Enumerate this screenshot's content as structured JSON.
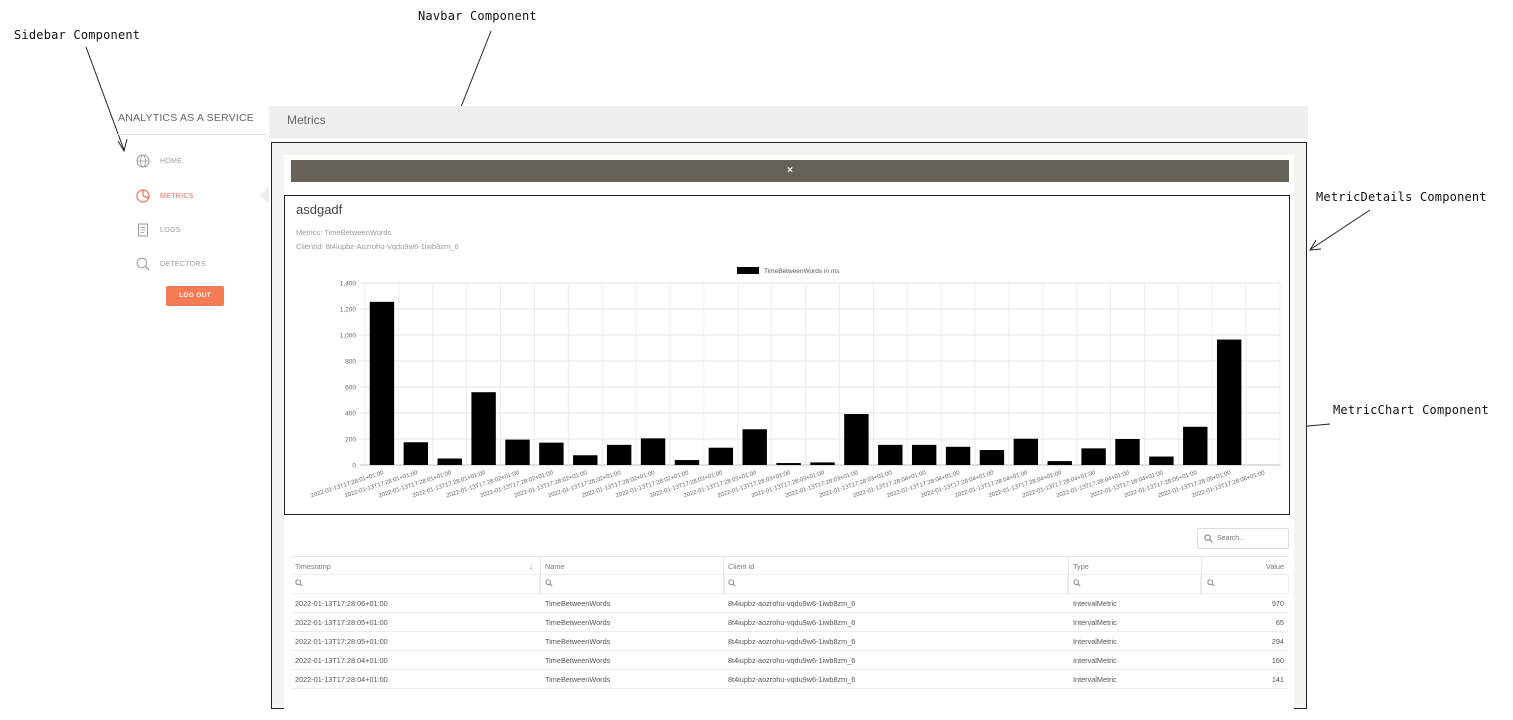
{
  "annotations": {
    "sidebar": "Sidebar Component",
    "navbar": "Navbar Component",
    "metric_details": "MetricDetails Component",
    "metric_chart": "MetricChart Component"
  },
  "sidebar": {
    "brand": "ANALYTICS AS A SERVICE",
    "items": [
      {
        "label": "HOME",
        "icon": "globe-icon",
        "active": false
      },
      {
        "label": "METRICS",
        "icon": "pie-chart-icon",
        "active": true
      },
      {
        "label": "LOGS",
        "icon": "document-icon",
        "active": false
      },
      {
        "label": "DETECTORS",
        "icon": "search-icon",
        "active": false
      }
    ],
    "logout_label": "LOG OUT",
    "accent_color": "#f0714f"
  },
  "navbar": {
    "title": "Metrics"
  },
  "close_label": "×",
  "details": {
    "title": "asdgadf",
    "metrics_line": "Metrics: TimeBetweenWords",
    "client_line": "ClientId: 8t4iupbz-Aozrohu-Vqdu9w6-1iwb8zm_6"
  },
  "chart_data": {
    "type": "bar",
    "legend": "TimeBetweenWords in ms",
    "legend_position": "top-center",
    "color": "#000000",
    "grid": true,
    "ylim": [
      0,
      1400
    ],
    "yticks": [
      "0",
      "200",
      "400",
      "600",
      "800",
      "1,000",
      "1,200",
      "1,400"
    ],
    "categories": [
      "2022-01-13T17:28:01+01:00",
      "2022-01-13T17:28:01+01:00",
      "2022-01-13T17:28:01+01:00",
      "2022-01-13T17:28:01+01:00",
      "2022-01-13T17:28:02+01:00",
      "2022-01-13T17:28:02+01:00",
      "2022-01-13T17:28:02+01:00",
      "2022-01-13T17:28:02+01:00",
      "2022-01-13T17:28:02+01:00",
      "2022-01-13T17:28:02+01:00",
      "2022-01-13T17:28:03+01:00",
      "2022-01-13T17:28:03+01:00",
      "2022-01-13T17:28:03+01:00",
      "2022-01-13T17:28:03+01:00",
      "2022-01-13T17:28:03+01:00",
      "2022-01-13T17:28:03+01:00",
      "2022-01-13T17:28:04+01:00",
      "2022-01-13T17:28:04+01:00",
      "2022-01-13T17:28:04+01:00",
      "2022-01-13T17:28:04+01:00",
      "2022-01-13T17:28:04+01:00",
      "2022-01-13T17:28:04+01:00",
      "2022-01-13T17:28:04+01:00",
      "2022-01-13T17:28:04+01:00",
      "2022-01-13T17:28:05+01:00",
      "2022-01-13T17:28:05+01:00",
      "2022-01-13T17:28:06+01:00"
    ],
    "values": [
      1255,
      175,
      50,
      560,
      195,
      172,
      75,
      155,
      205,
      38,
      133,
      275,
      15,
      20,
      392,
      155,
      155,
      140,
      115,
      202,
      30,
      128,
      200,
      65,
      294,
      965
    ]
  },
  "search": {
    "placeholder": "Search..."
  },
  "table": {
    "columns": [
      "Timestamp",
      "Name",
      "Client id",
      "Type",
      "Value"
    ],
    "sort_icon": "↓",
    "filter_icon": "search-icon",
    "rows": [
      {
        "timestamp": "2022-01-13T17:28:06+01:00",
        "name": "TimeBetweenWords",
        "client": "8t4iupbz-aozrohu-vqdu9w6-1iwb8zm_6",
        "type": "IntervalMetric",
        "value": "970"
      },
      {
        "timestamp": "2022-01-13T17:28:05+01:00",
        "name": "TimeBetweenWords",
        "client": "8t4iupbz-aozrohu-vqdu9w6-1iwb8zm_6",
        "type": "IntervalMetric",
        "value": "65"
      },
      {
        "timestamp": "2022-01-13T17:28:05+01:00",
        "name": "TimeBetweenWords",
        "client": "8t4iupbz-aozrohu-vqdu9w6-1iwb8zm_6",
        "type": "IntervalMetric",
        "value": "294"
      },
      {
        "timestamp": "2022-01-13T17:28:04+01:00",
        "name": "TimeBetweenWords",
        "client": "8t4iupbz-aozrohu-vqdu9w6-1iwb8zm_6",
        "type": "IntervalMetric",
        "value": "160"
      },
      {
        "timestamp": "2022-01-13T17:28:04+01:00",
        "name": "TimeBetweenWords",
        "client": "8t4iupbz-aozrohu-vqdu9w6-1iwb8zm_6",
        "type": "IntervalMetric",
        "value": "141"
      }
    ]
  }
}
